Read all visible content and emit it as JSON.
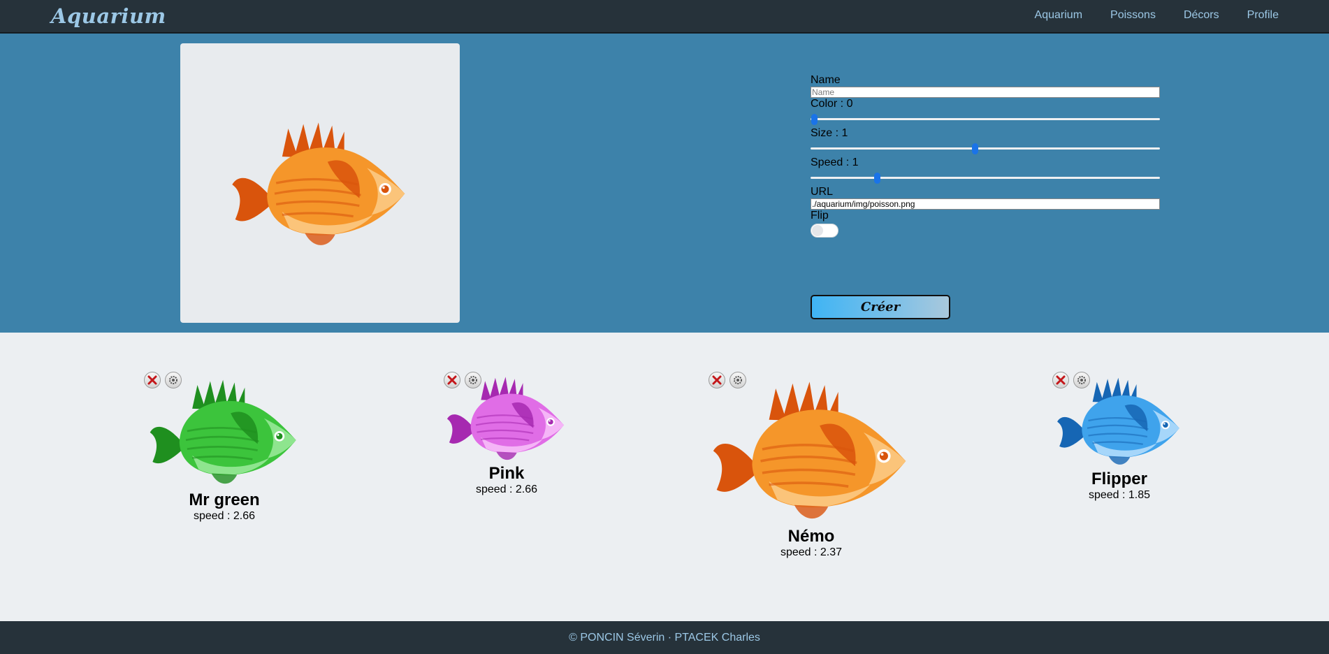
{
  "nav": {
    "brand": "Aquarium",
    "links": [
      "Aquarium",
      "Poissons",
      "Décors",
      "Profile"
    ]
  },
  "form": {
    "name_label": "Name",
    "name_placeholder": "Name",
    "name_value": "",
    "color_label": "Color : 0",
    "color_level": 0.01,
    "size_label": "Size : 1",
    "size_level": 0.47,
    "speed_label": "Speed : 1",
    "speed_level": 0.19,
    "url_label": "URL",
    "url_value": "./aquarium/img/poisson.png",
    "flip_label": "Flip",
    "flip_on": false,
    "create_label": "Créer"
  },
  "fishes": [
    {
      "name": "Mr green",
      "speed": "speed : 2.66",
      "color": "#3cc43c"
    },
    {
      "name": "Pink",
      "speed": "speed : 2.66",
      "color": "#e06de6"
    },
    {
      "name": "Némo",
      "speed": "speed : 2.37",
      "color": "#f28a1c"
    },
    {
      "name": "Flipper",
      "speed": "speed : 1.85",
      "color": "#3fa3ec"
    }
  ],
  "footer": {
    "text": "© PONCIN Séverin · PTACEK Charles"
  },
  "colors": {
    "nav_bg": "#26323a",
    "band_bg": "#3d82aa",
    "page_bg": "#eceff2",
    "accent": "#9cc8e6"
  }
}
